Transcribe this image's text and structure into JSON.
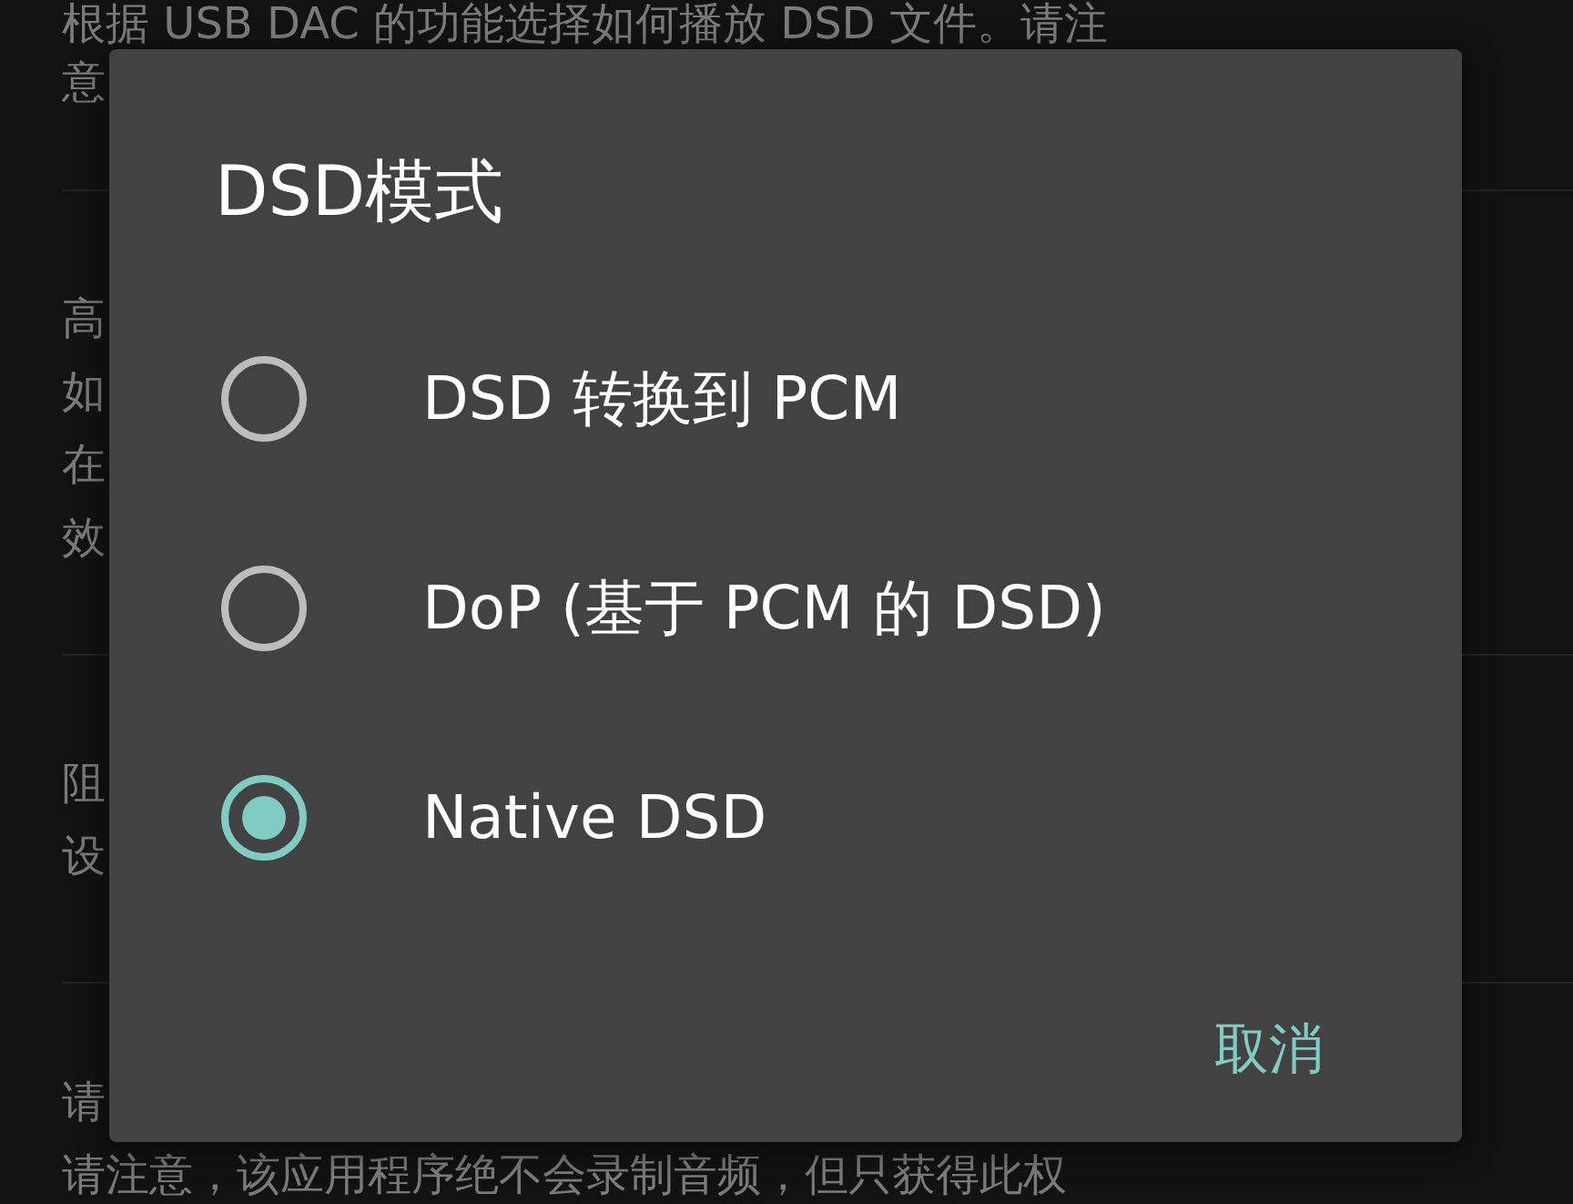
{
  "background_settings": [
    {
      "lines": [
        "根据 USB DAC 的功能选择如何播放 DSD 文件。请注",
        "意"
      ]
    },
    {
      "lines": [
        "高",
        "如",
        "在",
        "效"
      ]
    },
    {
      "lines": [
        "阻",
        "设"
      ]
    },
    {
      "lines": [
        "请",
        "请注意，该应用程序绝不会录制音频，但只获得此权"
      ]
    }
  ],
  "dialog": {
    "title": "DSD模式",
    "options": [
      {
        "label": "DSD 转换到 PCM",
        "selected": false
      },
      {
        "label": "DoP (基于 PCM 的 DSD)",
        "selected": false
      },
      {
        "label": "Native DSD",
        "selected": true
      }
    ],
    "buttons": [
      "取消"
    ]
  }
}
